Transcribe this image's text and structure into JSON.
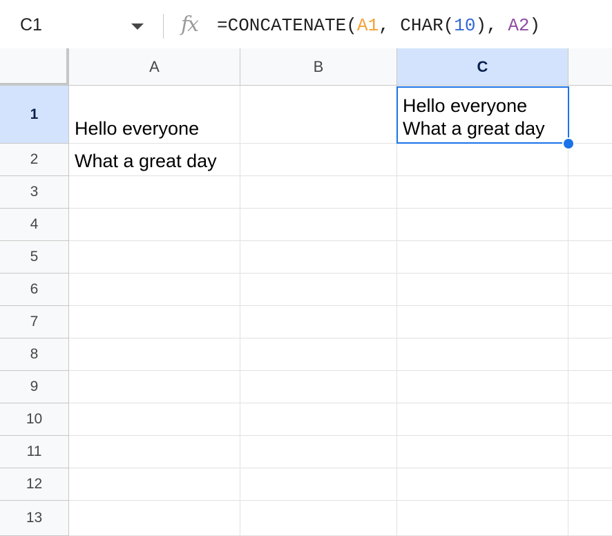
{
  "formula_bar": {
    "name_box": "C1",
    "fx_label": "fx",
    "formula": {
      "prefix": "=CONCATENATE(",
      "ref_a1": "A1",
      "sep1": ", CHAR(",
      "num": "10",
      "sep2": "), ",
      "ref_a2": "A2",
      "suffix": ")"
    }
  },
  "columns": [
    {
      "label": "A"
    },
    {
      "label": "B"
    },
    {
      "label": "C",
      "selected": true
    }
  ],
  "rows": [
    "1",
    "2",
    "3",
    "4",
    "5",
    "6",
    "7",
    "8",
    "9",
    "10",
    "11",
    "12",
    "13"
  ],
  "cells": {
    "A1": "Hello everyone",
    "A2": "What a great day",
    "C1": "Hello everyone\nWhat a great day"
  },
  "selected_cell": "C1",
  "colors": {
    "selection": "#1a73e8",
    "header_selected": "#d3e3fd",
    "ref_a1": "#f4a133",
    "ref_num": "#3367d6",
    "ref_a2": "#8d4ca1"
  }
}
